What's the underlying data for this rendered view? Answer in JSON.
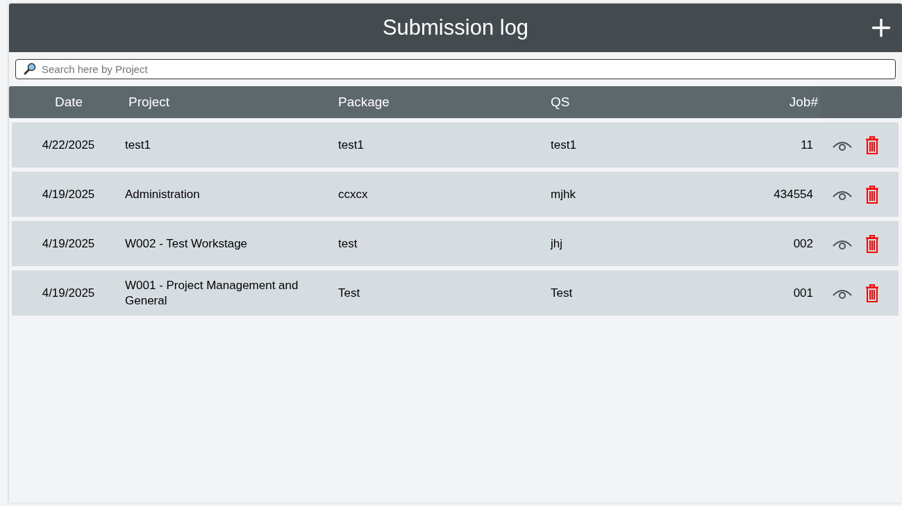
{
  "header": {
    "title": "Submission log"
  },
  "search": {
    "placeholder": "Search here by Project"
  },
  "table": {
    "columns": [
      "Date",
      "Project",
      "Package",
      "QS",
      "Job#"
    ],
    "rows": [
      {
        "date": "4/22/2025",
        "project": "test1",
        "package": "test1",
        "qs": "test1",
        "job": "11"
      },
      {
        "date": "4/19/2025",
        "project": "Administration",
        "package": "ccxcx",
        "qs": "mjhk",
        "job": "434554"
      },
      {
        "date": "4/19/2025",
        "project": "W002 - Test Workstage",
        "package": "test",
        "qs": "jhj",
        "job": "002"
      },
      {
        "date": "4/19/2025",
        "project": "W001 - Project Management and General",
        "package": "Test",
        "qs": "Test",
        "job": "001"
      }
    ]
  }
}
